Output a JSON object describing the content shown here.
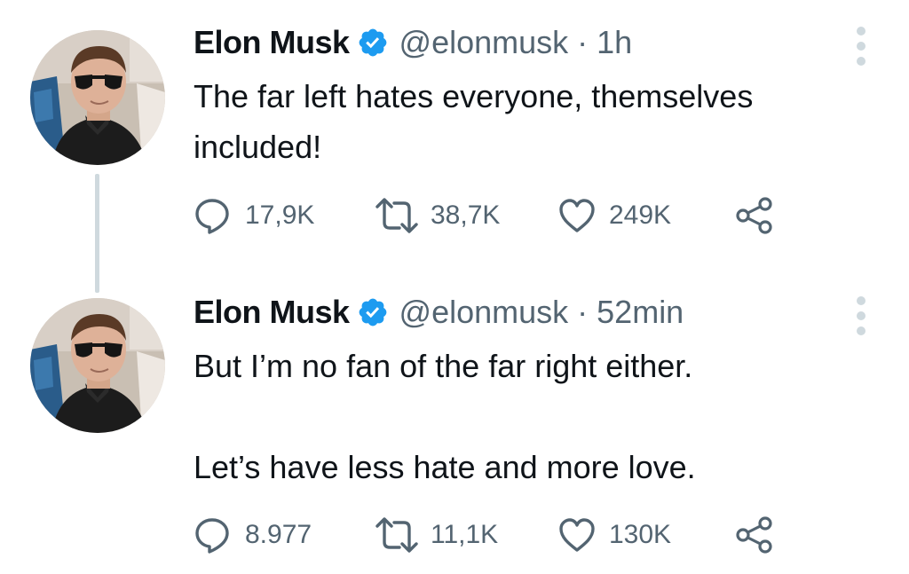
{
  "tweets": [
    {
      "author": {
        "name": "Elon Musk",
        "handle": "@elonmusk",
        "verified": true,
        "avatar": "profile-photo"
      },
      "separator": "·",
      "time": "1h",
      "text": [
        "The far left hates everyone, themselves",
        "included!"
      ],
      "stats": {
        "replies": "17,9K",
        "retweets": "38,7K",
        "likes": "249K"
      }
    },
    {
      "author": {
        "name": "Elon Musk",
        "handle": "@elonmusk",
        "verified": true,
        "avatar": "profile-photo"
      },
      "separator": "·",
      "time": "52min",
      "text": [
        "But I’m no fan of the far right either.",
        "Let’s have less hate and more love."
      ],
      "stats": {
        "replies": "8.977",
        "retweets": "11,1K",
        "likes": "130K"
      }
    }
  ],
  "icons": {
    "reply": "reply-icon",
    "retweet": "retweet-icon",
    "like": "heart-icon",
    "share": "share-icon",
    "verified": "verified-badge-icon",
    "more": "more-options-icon"
  },
  "colors": {
    "text": "#0f1419",
    "secondary": "#536471",
    "verified": "#1d9bf0",
    "thread_line": "#cfd9de",
    "background": "#ffffff"
  }
}
